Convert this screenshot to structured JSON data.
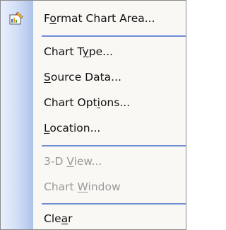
{
  "menu": {
    "items": [
      {
        "pre": "F",
        "acc": "o",
        "post": "rmat Chart Area...",
        "enabled": true,
        "icon": "format-chart-area-icon"
      },
      {
        "pre": "Chart T",
        "acc": "y",
        "post": "pe...",
        "enabled": true
      },
      {
        "pre": "",
        "acc": "S",
        "post": "ource Data...",
        "enabled": true
      },
      {
        "pre": "Chart Opt",
        "acc": "i",
        "post": "ons...",
        "enabled": true
      },
      {
        "pre": "",
        "acc": "L",
        "post": "ocation...",
        "enabled": true
      },
      {
        "pre": "3-D ",
        "acc": "V",
        "post": "iew...",
        "enabled": false
      },
      {
        "pre": "Chart ",
        "acc": "W",
        "post": "indow",
        "enabled": false
      },
      {
        "pre": "Cle",
        "acc": "a",
        "post": "r",
        "enabled": true
      }
    ]
  },
  "colors": {
    "menu_background": "#f9f8f4",
    "gutter_light": "#eaf1fd",
    "gutter_dark": "#aec3ea",
    "separator": "#6f8fd4",
    "disabled_text": "#9a9a9a"
  }
}
